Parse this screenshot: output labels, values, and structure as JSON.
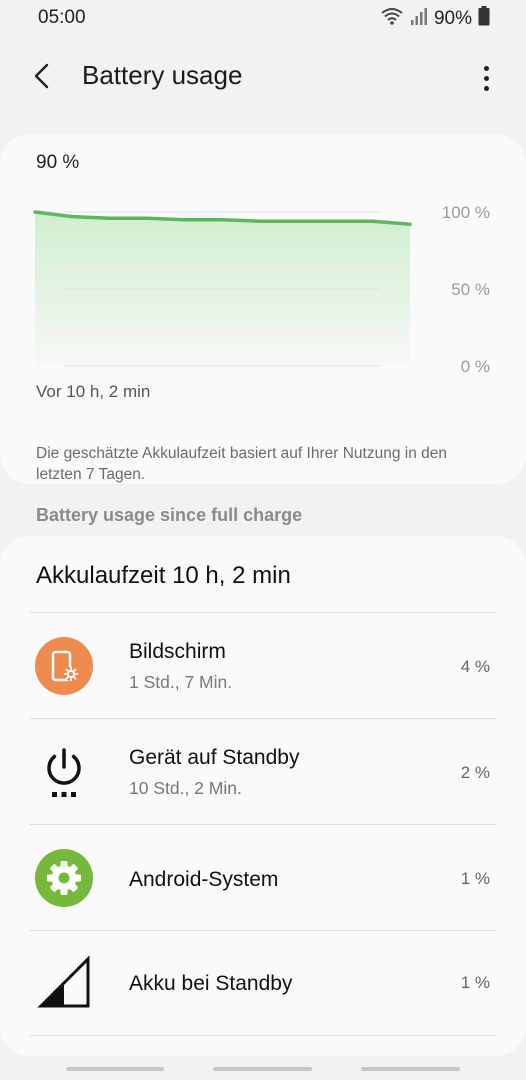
{
  "status_bar": {
    "time": "05:00",
    "battery_pct": "90%",
    "icons": [
      "wifi-icon",
      "cellular-signal-icon",
      "battery-icon"
    ]
  },
  "header": {
    "title": "Battery usage",
    "back_icon": "back-arrow-icon",
    "menu_icon": "more-vert-icon"
  },
  "chart": {
    "current_level": "90 %",
    "time_label": "Vor 10 h, 2 min",
    "note": "Die geschätzte Akkulaufzeit basiert auf Ihrer Nutzung in den letzten 7 Tagen.",
    "line_color": "#5cb85c",
    "fill_color": "#c8ecc8"
  },
  "chart_data": {
    "type": "area",
    "title": "",
    "xlabel": "",
    "ylabel": "",
    "ylim": [
      0,
      100
    ],
    "y_ticks": [
      "100 %",
      "50 %",
      "0 %"
    ],
    "x": [
      0,
      1,
      2,
      3,
      4,
      5,
      6,
      7,
      8,
      9,
      10
    ],
    "series": [
      {
        "values": [
          100,
          97,
          96,
          96,
          95,
          95,
          94,
          94,
          94,
          94,
          92
        ]
      }
    ]
  },
  "section": {
    "title": "Battery usage since full charge"
  },
  "usage": {
    "total": "Akkulaufzeit 10 h, 2 min",
    "items": [
      {
        "name": "Bildschirm",
        "sub": "1 Std., 7 Min.",
        "pct": "4 %",
        "icon": "screen-brightness-icon",
        "color": "#ee8a4e"
      },
      {
        "name": "Gerät auf Standby",
        "sub": "10 Std., 2 Min.",
        "pct": "2 %",
        "icon": "power-standby-icon",
        "color": "#111111"
      },
      {
        "name": "Android-System",
        "sub": "",
        "pct": "1 %",
        "icon": "settings-gear-icon",
        "color": "#76b83b"
      },
      {
        "name": "Akku bei Standby",
        "sub": "",
        "pct": "1 %",
        "icon": "signal-strength-icon",
        "color": "#111111"
      }
    ]
  }
}
